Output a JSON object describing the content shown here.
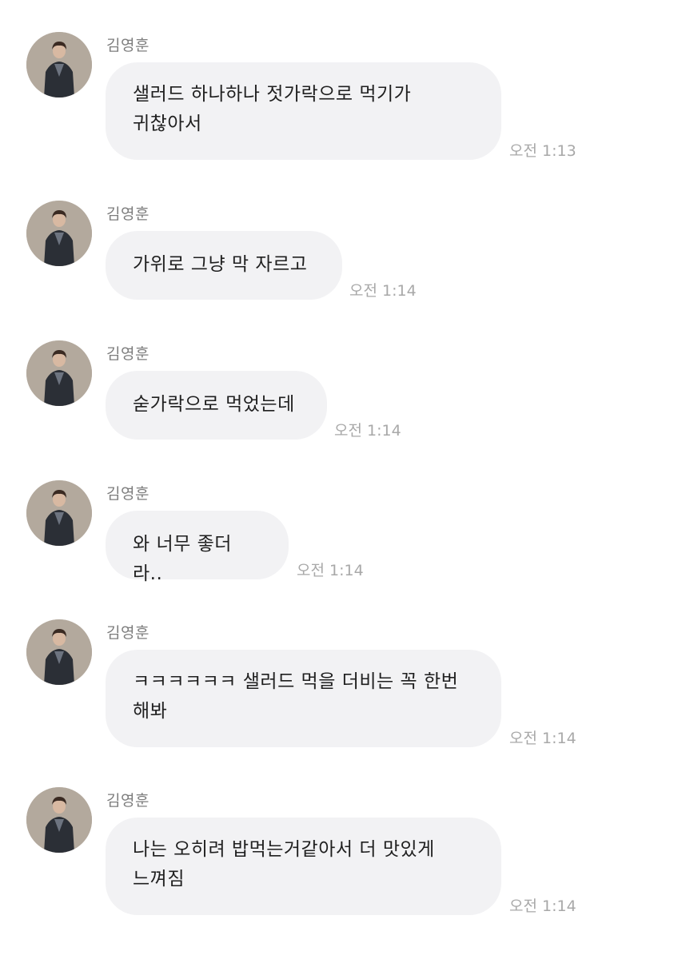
{
  "messages": [
    {
      "sender": "김영훈",
      "text": "샐러드 하나하나 젓가락으로 먹기가\n귀찮아서",
      "time": "오전 1:13"
    },
    {
      "sender": "김영훈",
      "text": "가위로 그냥 막 자르고",
      "time": "오전 1:14"
    },
    {
      "sender": "김영훈",
      "text": "숟가락으로 먹었는데",
      "time": "오전 1:14"
    },
    {
      "sender": "김영훈",
      "text": "와 너무 좋더라..",
      "time": "오전 1:14"
    },
    {
      "sender": "김영훈",
      "text": "ㅋㅋㅋㅋㅋㅋ 샐러드 먹을 더비는 꼭 한번\n해봐",
      "time": "오전 1:14"
    },
    {
      "sender": "김영훈",
      "text": "나는 오히려 밥먹는거같아서 더 맛있게\n느껴짐",
      "time": "오전 1:14"
    }
  ]
}
